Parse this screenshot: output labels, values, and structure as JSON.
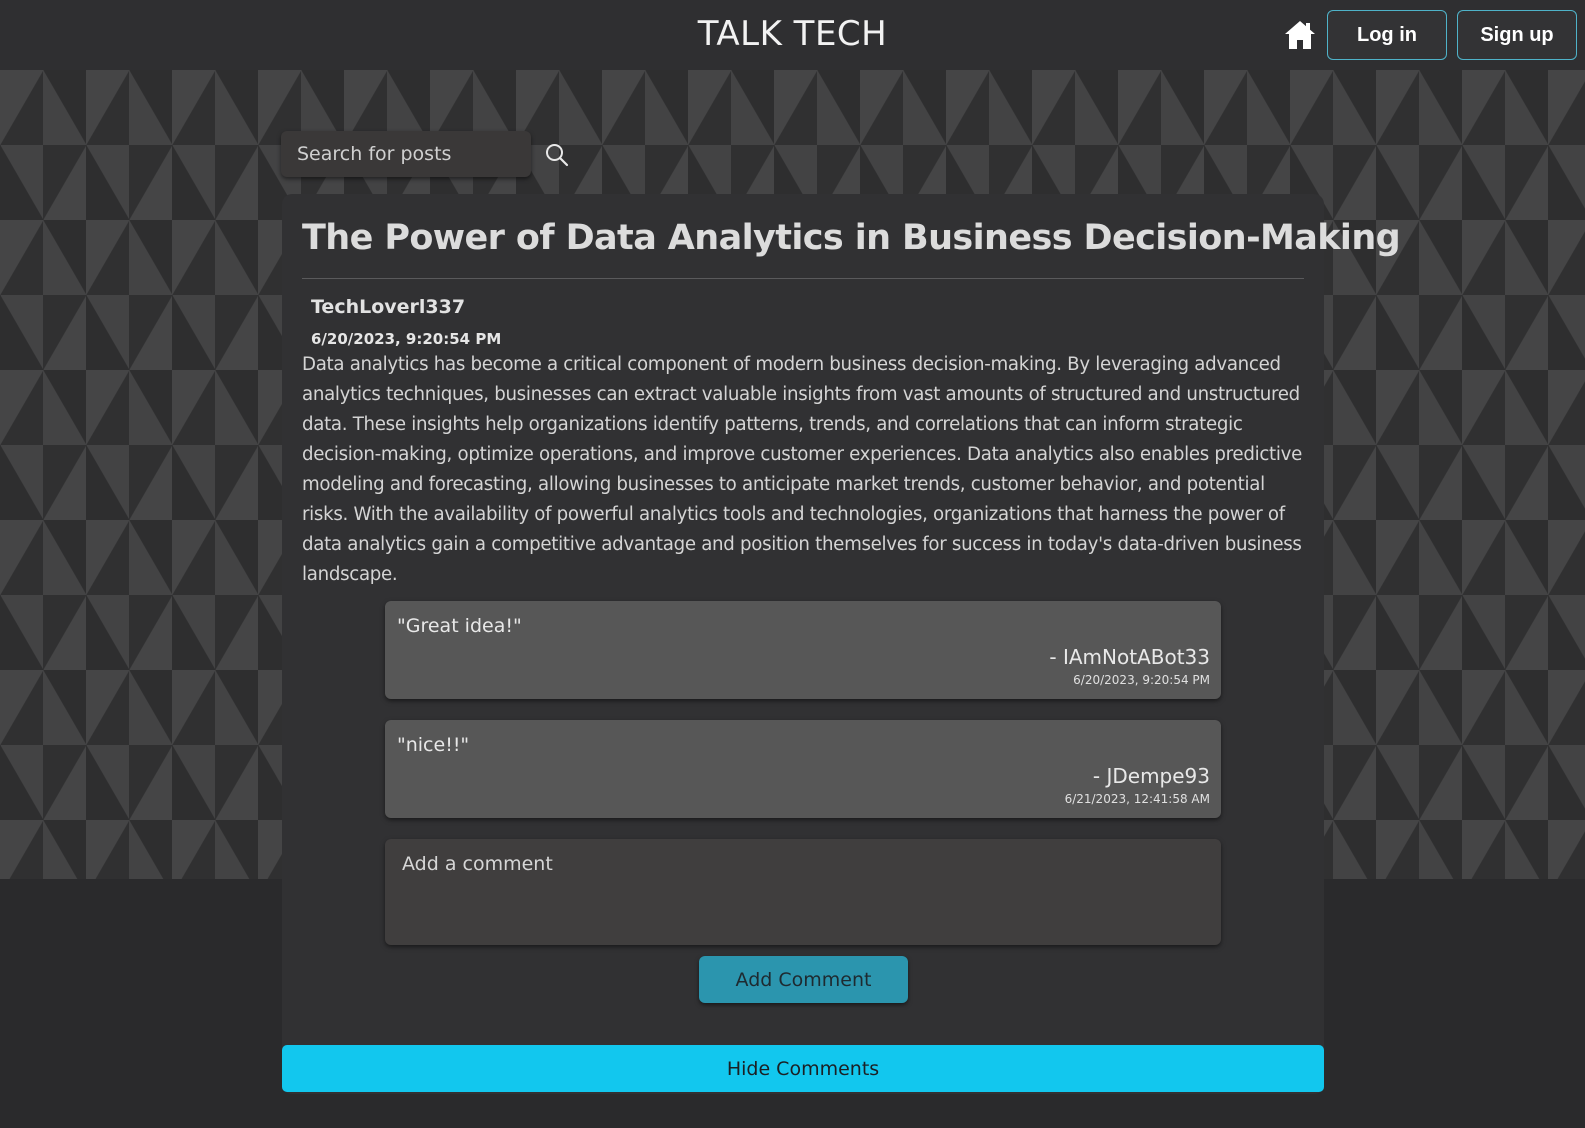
{
  "header": {
    "brand": "TALK TECH",
    "home_icon": "home-icon",
    "login_label": "Log in",
    "signup_label": "Sign up"
  },
  "search": {
    "placeholder": "Search for posts",
    "icon": "search-icon"
  },
  "post": {
    "title": "The Power of Data Analytics in Business Decision-Making",
    "author": "TechLoverl337",
    "date": "6/20/2023, 9:20:54 PM",
    "body": "Data analytics has become a critical component of modern business decision-making. By leveraging advanced analytics techniques, businesses can extract valuable insights from vast amounts of structured and unstructured data. These insights help organizations identify patterns, trends, and correlations that can inform strategic decision-making, optimize operations, and improve customer experiences. Data analytics also enables predictive modeling and forecasting, allowing businesses to anticipate market trends, customer behavior, and potential risks. With the availability of powerful analytics tools and technologies, organizations that harness the power of data analytics gain a competitive advantage and position themselves for success in today's data-driven business landscape."
  },
  "comments": [
    {
      "text": "\"Great idea!\"",
      "author": "- IAmNotABot33",
      "date": "6/20/2023, 9:20:54 PM"
    },
    {
      "text": "\"nice!!\"",
      "author": "- JDempe93",
      "date": "6/21/2023, 12:41:58 AM"
    }
  ],
  "comment_form": {
    "placeholder": "Add a comment",
    "submit_label": "Add Comment"
  },
  "hide_comments_label": "Hide Comments",
  "colors": {
    "accent": "#12c7ee",
    "button_teal": "#2b95ae",
    "background": "#2a2a2c",
    "card": "#313133"
  }
}
